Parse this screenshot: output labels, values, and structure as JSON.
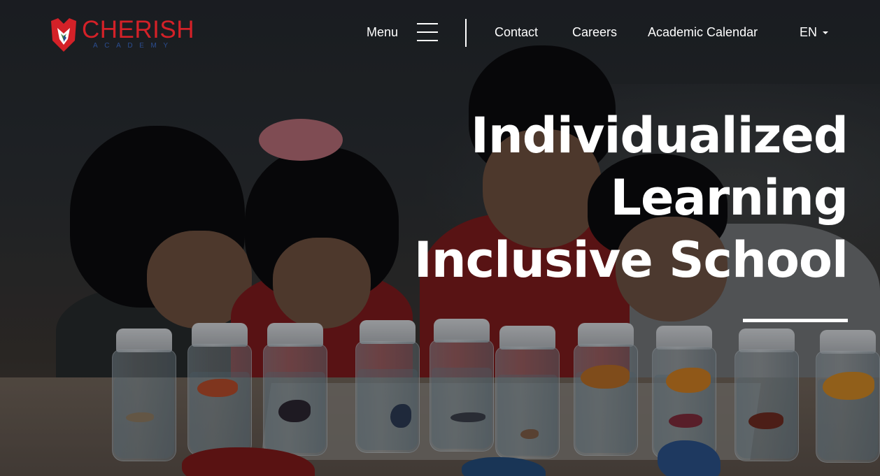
{
  "brand": {
    "name": "CHERISH",
    "sub": "ACADEMY",
    "colors": {
      "primary": "#d42128",
      "secondary": "#2b4d8f"
    }
  },
  "nav": {
    "menu_label": "Menu",
    "menu_icon": "hamburger-icon",
    "links": [
      "Contact",
      "Careers",
      "Academic Calendar"
    ],
    "language": "EN",
    "language_icon": "caret-down-icon"
  },
  "hero": {
    "lines": [
      "Individualized",
      "Learning",
      "Inclusive School"
    ]
  }
}
